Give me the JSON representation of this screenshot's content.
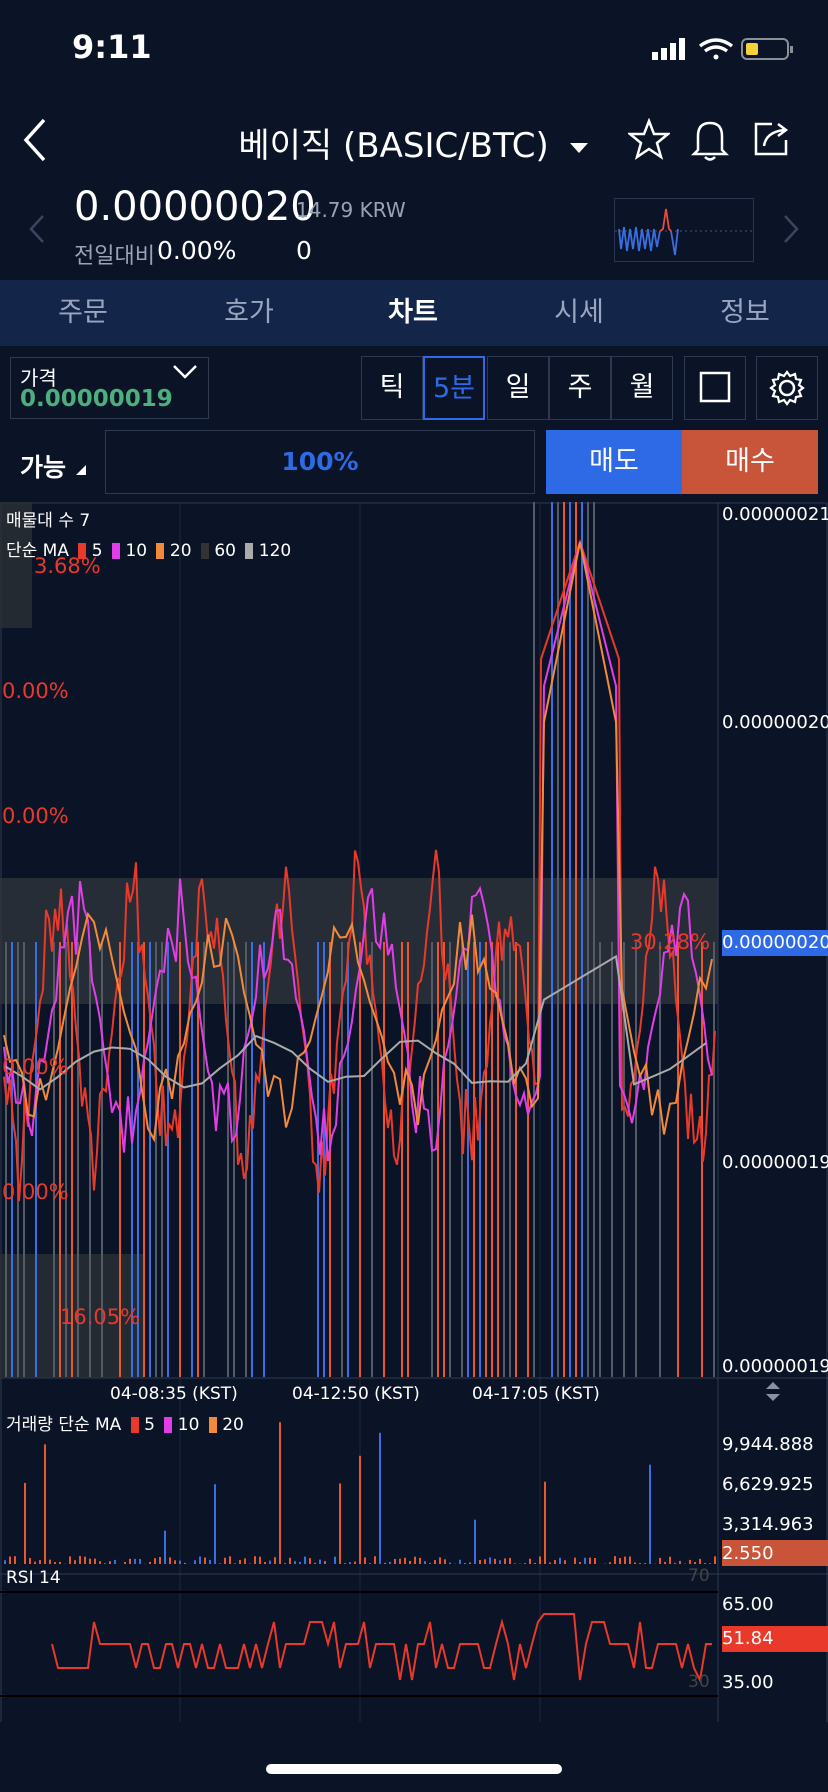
{
  "status_bar": {
    "time": "9:11"
  },
  "header": {
    "title": "베이직 (BASIC/BTC)"
  },
  "ticker": {
    "price": "0.00000020",
    "krw": "14.79 KRW",
    "compare_label": "전일대비",
    "compare_value": "0.00%",
    "volume": "0"
  },
  "tabs": [
    "주문",
    "호가",
    "차트",
    "시세",
    "정보"
  ],
  "active_tab": "차트",
  "price_field": {
    "label": "가격",
    "value": "0.00000019"
  },
  "periods": [
    "틱",
    "5분",
    "일",
    "주",
    "월"
  ],
  "active_period": "5분",
  "order": {
    "available_label": "가능",
    "percent": "100%",
    "sell_label": "매도",
    "buy_label": "매수"
  },
  "colors": {
    "background": "#0b1426",
    "tabbar": "#14254a",
    "accent_blue": "#2f6ae6",
    "accent_red": "#c8543a",
    "ma5": "#e8392b",
    "ma10": "#e23ee8",
    "ma20": "#f28a3c",
    "ma60": "#333333",
    "ma120": "#aaaaaa"
  },
  "main_chart": {
    "profile_label": "매물대 수 7",
    "ma_label": "단순 MA",
    "ma_periods": [
      "5",
      "10",
      "20",
      "60",
      "120"
    ],
    "profile_percents": [
      "3.68%",
      "0.00%",
      "0.00%",
      "0.00%",
      "0.00%",
      "16.05%",
      "30.28%"
    ],
    "y_ticks": [
      "0.00000021",
      "0.00000020",
      "0.00000020",
      "0.00000019",
      "0.00000019"
    ],
    "current_price": "0.00000020",
    "x_ticks": [
      "04-08:35 (KST)",
      "04-12:50 (KST)",
      "04-17:05 (KST)"
    ]
  },
  "volume_chart": {
    "label": "거래량 단순 MA",
    "ma_periods": [
      "5",
      "10",
      "20"
    ],
    "y_ticks": [
      "9,944.888",
      "6,629.925",
      "3,314.963"
    ],
    "current": "2.550"
  },
  "rsi_chart": {
    "label": "RSI 14",
    "upper": "70",
    "lower": "30",
    "y_ticks": [
      "65.00",
      "35.00"
    ],
    "current": "51.84"
  }
}
